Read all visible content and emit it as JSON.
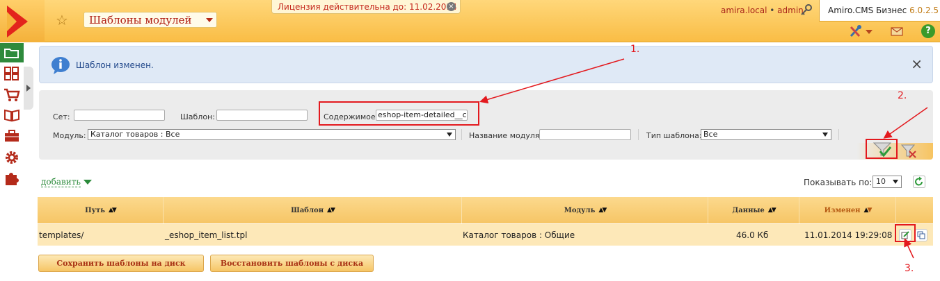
{
  "header": {
    "section_title": "Шаблоны модулей",
    "license_text": "Лицензия действительна до: 11.02.2014",
    "license_close": "×",
    "user_host": "amira.local",
    "user_sep": " • ",
    "user_name": "admin",
    "brand_name": "Amiro.CMS Бизнес",
    "brand_version": "6.0.2.5",
    "help_label": "?",
    "icons": [
      "logo-arrow-icon",
      "star-icon",
      "key-icon",
      "tools-icon",
      "mail-icon",
      "help-icon"
    ]
  },
  "sidebar": {
    "items": [
      {
        "icon": "folder-icon",
        "active": true
      },
      {
        "icon": "grid-icon"
      },
      {
        "icon": "cart-icon"
      },
      {
        "icon": "book-icon"
      },
      {
        "icon": "briefcase-icon"
      },
      {
        "icon": "gear-icon"
      },
      {
        "icon": "puzzle-icon"
      }
    ]
  },
  "notice": {
    "text": "Шаблон изменен.",
    "close": "×"
  },
  "filter": {
    "set_label": "Сет:",
    "set_value": "",
    "template_label": "Шаблон:",
    "template_value": "",
    "content_label": "Содержимое:",
    "content_value": "eshop-item-detailed__c",
    "module_label": "Модуль:",
    "module_value": "Каталог товаров : Все",
    "module_name_label": "Название модуля:",
    "module_name_value": "",
    "template_type_label": "Тип шаблона:",
    "template_type_value": "Все"
  },
  "toolbar": {
    "add_label": "добавить",
    "per_page_label": "Показывать по:",
    "per_page_value": "10"
  },
  "table": {
    "columns": [
      "Путь",
      "Шаблон",
      "Модуль",
      "Данные",
      "Изменен"
    ],
    "rows": [
      {
        "path": "templates/",
        "template": "_eshop_item_list.tpl",
        "module": "Каталог товаров : Общие",
        "size": "46.0 Кб",
        "modified": "11.01.2014 19:29:08"
      }
    ]
  },
  "buttons": {
    "save": "Сохранить шаблоны на диск",
    "restore": "Восстановить шаблоны с диска"
  },
  "annotations": {
    "labels": [
      "1.",
      "2.",
      "3."
    ],
    "color": "#e3191e"
  },
  "colors": {
    "accent_orange": "#f9bd45",
    "brand_red": "#e3241c",
    "active_green": "#2e8a3c",
    "notice_blue": "#dfe9f6"
  }
}
